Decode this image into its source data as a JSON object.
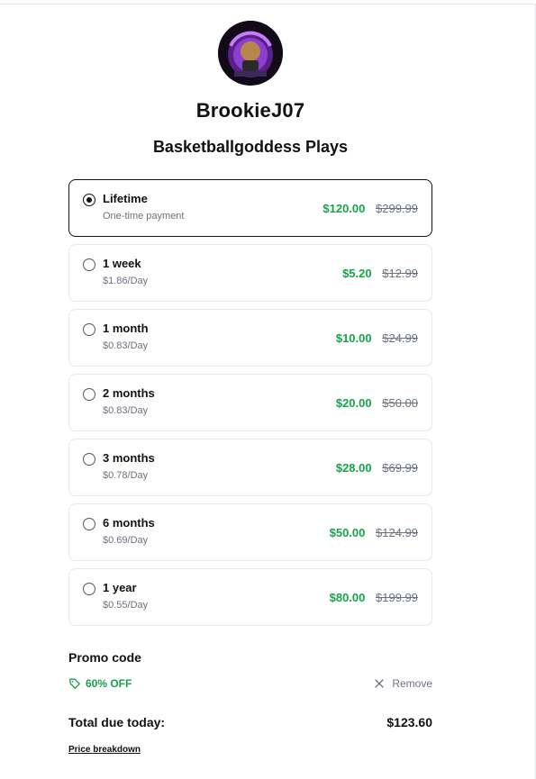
{
  "profile": {
    "username": "BrookieJ07",
    "product_title": "Basketballgoddess Plays",
    "avatar_icon": "profile-avatar-icon"
  },
  "plans": [
    {
      "name": "Lifetime",
      "sub": "One-time payment",
      "price": "$120.00",
      "original_price": "$299.99",
      "selected": true
    },
    {
      "name": "1 week",
      "sub": "$1.86/Day",
      "price": "$5.20",
      "original_price": "$12.99",
      "selected": false
    },
    {
      "name": "1 month",
      "sub": "$0.83/Day",
      "price": "$10.00",
      "original_price": "$24.99",
      "selected": false
    },
    {
      "name": "2 months",
      "sub": "$0.83/Day",
      "price": "$20.00",
      "original_price": "$50.00",
      "selected": false
    },
    {
      "name": "3 months",
      "sub": "$0.78/Day",
      "price": "$28.00",
      "original_price": "$69.99",
      "selected": false
    },
    {
      "name": "6 months",
      "sub": "$0.69/Day",
      "price": "$50.00",
      "original_price": "$124.99",
      "selected": false
    },
    {
      "name": "1 year",
      "sub": "$0.55/Day",
      "price": "$80.00",
      "original_price": "$199.99",
      "selected": false
    }
  ],
  "promo": {
    "title": "Promo code",
    "code_label": "60% OFF",
    "remove_label": "Remove"
  },
  "total": {
    "label": "Total due today:",
    "value": "$123.60"
  },
  "breakdown_link": "Price breakdown",
  "colors": {
    "accent_green": "#16a34a",
    "muted_gray": "#6b7280",
    "text_dark": "#111111",
    "border": "#e5e7eb"
  }
}
